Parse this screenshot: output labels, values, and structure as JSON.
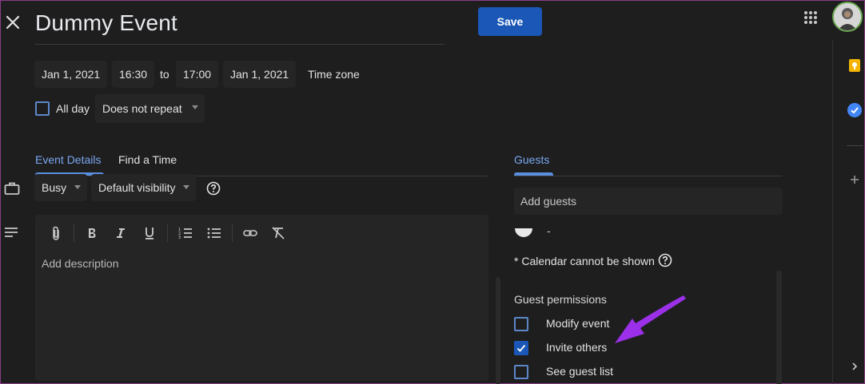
{
  "header": {
    "title": "Dummy Event",
    "save_label": "Save"
  },
  "datetime": {
    "start_date": "Jan 1, 2021",
    "start_time": "16:30",
    "to_label": "to",
    "end_time": "17:00",
    "end_date": "Jan 1, 2021",
    "timezone_label": "Time zone"
  },
  "options": {
    "all_day_label": "All day",
    "all_day_checked": false,
    "repeat_value": "Does not repeat"
  },
  "tabs": {
    "event_details": "Event Details",
    "find_a_time": "Find a Time"
  },
  "details": {
    "availability_value": "Busy",
    "visibility_value": "Default visibility",
    "description_placeholder": "Add description"
  },
  "toolbar": {
    "icons": [
      "attach-icon",
      "bold-icon",
      "italic-icon",
      "underline-icon",
      "numbered-list-icon",
      "bulleted-list-icon",
      "link-icon",
      "clear-formatting-icon"
    ]
  },
  "guests": {
    "tab_label": "Guests",
    "add_placeholder": "Add guests",
    "guest_name": "-",
    "calendar_note": "* Calendar cannot be shown",
    "permissions_title": "Guest permissions",
    "permissions": [
      {
        "label": "Modify event",
        "checked": false
      },
      {
        "label": "Invite others",
        "checked": true
      },
      {
        "label": "See guest list",
        "checked": false
      }
    ]
  },
  "colors": {
    "accent": "#1a57b6",
    "tab_active": "#7aa7f0",
    "annotation_arrow": "#9b30e8",
    "keep": "#f4b400",
    "tasks": "#4285f4"
  }
}
